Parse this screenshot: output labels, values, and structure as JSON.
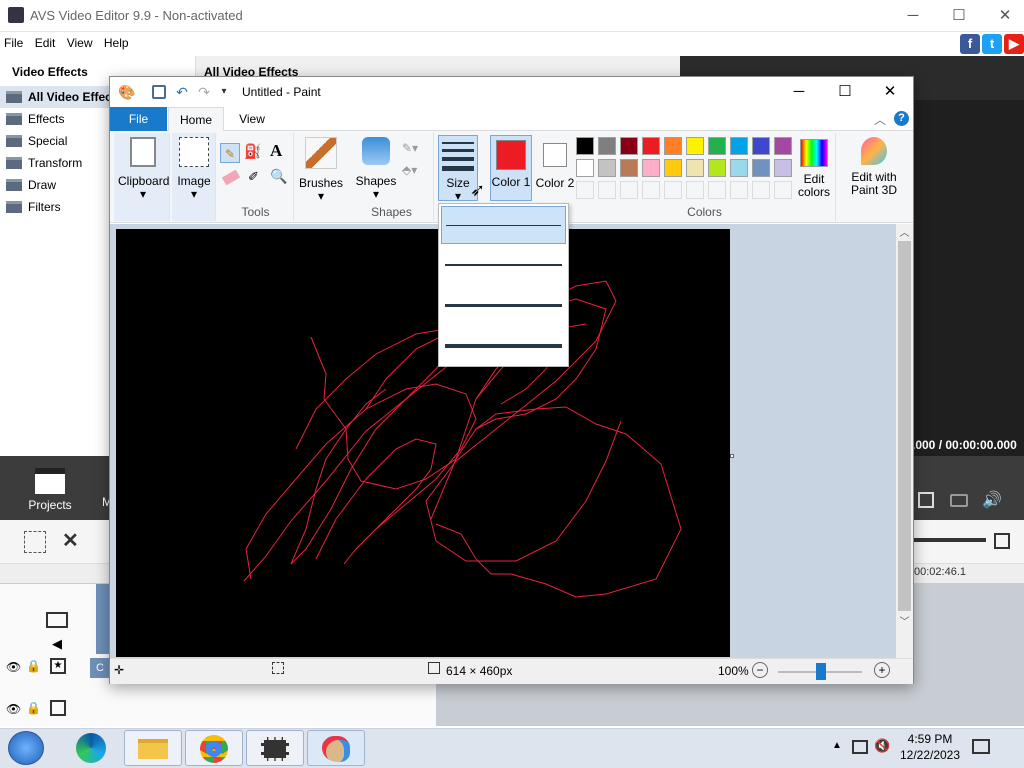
{
  "avs": {
    "title": "AVS Video Editor 9.9 - Non-activated",
    "menu": [
      "File",
      "Edit",
      "View",
      "Help"
    ],
    "left_header": "Video Effects",
    "mid_header": "All Video Effects",
    "tree": [
      "All Video Effects",
      "Effects",
      "Special",
      "Transform",
      "Draw",
      "Filters"
    ],
    "time": ".000  /  00:00:00.000",
    "projects_label": "Projects",
    "projects_extra": "M",
    "timeline_time": "00:02:46.1",
    "clip_label": "C"
  },
  "paint": {
    "title": "Untitled - Paint",
    "tabs": {
      "file": "File",
      "home": "Home",
      "view": "View"
    },
    "groups": {
      "clipboard": "Clipboard",
      "image": "Image",
      "tools": "Tools",
      "brushes": "Brushes",
      "shapes": "Shapes",
      "size": "Size",
      "color1": "Color 1",
      "color2": "Color 2",
      "colors": "Colors",
      "edit_colors": "Edit colors",
      "edit_paint3d": "Edit with Paint 3D",
      "shapes_group": "Shapes"
    },
    "color1": "#ed1c24",
    "color2": "#ffffff",
    "palette_row1": [
      "#000000",
      "#7f7f7f",
      "#880015",
      "#ed1c24",
      "#ff7f27",
      "#fff200",
      "#22b14c",
      "#00a2e8",
      "#3f48cc",
      "#a349a4"
    ],
    "palette_row2": [
      "#ffffff",
      "#c3c3c3",
      "#b97a57",
      "#ffaec9",
      "#ffc90e",
      "#efe4b0",
      "#b5e61d",
      "#99d9ea",
      "#7092be",
      "#c8bfe7"
    ],
    "status": {
      "dimensions": "614 × 460px",
      "zoom": "100%"
    }
  },
  "taskbar": {
    "time": "4:59 PM",
    "date": "12/22/2023"
  }
}
